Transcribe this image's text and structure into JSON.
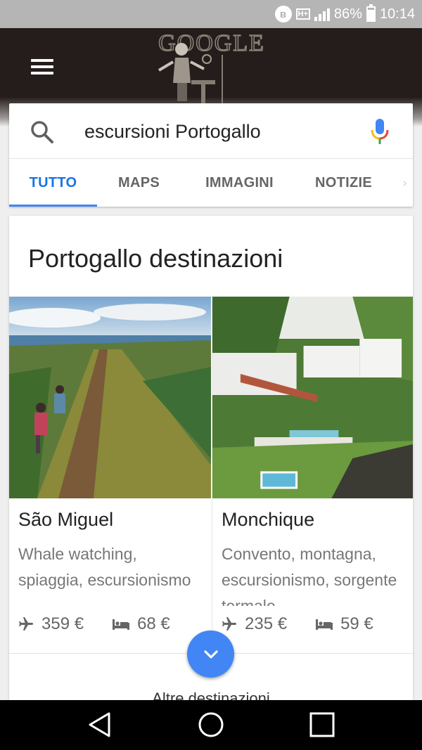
{
  "status_bar": {
    "battery": "86%",
    "time": "10:14",
    "network": "H+",
    "icons": [
      "bluetooth-icon",
      "network-ht-icon",
      "signal-icon",
      "battery-icon"
    ]
  },
  "header": {
    "doodle_text": "GOOGLE",
    "menu_icon": "hamburger-menu-icon"
  },
  "search": {
    "query": "escursioni Portogallo",
    "icons": [
      "search-icon",
      "mic-icon"
    ]
  },
  "tabs": [
    {
      "label": "TUTTO",
      "active": true
    },
    {
      "label": "MAPS",
      "active": false
    },
    {
      "label": "IMMAGINI",
      "active": false
    },
    {
      "label": "NOTIZIE",
      "active": false
    }
  ],
  "results": {
    "title": "Portogallo destinazioni",
    "destinations": [
      {
        "name": "São Miguel",
        "description": "Whale watching, spiaggia, escursionismo",
        "flight_price": "359 €",
        "hotel_price": "68 €"
      },
      {
        "name": "Monchique",
        "description": "Convento, montagna, escursionismo, sorgente termale",
        "flight_price": "235 €",
        "hotel_price": "59 €"
      }
    ],
    "more_link": "Altre destinazioni"
  },
  "colors": {
    "accent": "#4285f4",
    "tab_active": "#1a73e8",
    "status_bar": "#b5b5b5",
    "header": "#241d1c"
  }
}
